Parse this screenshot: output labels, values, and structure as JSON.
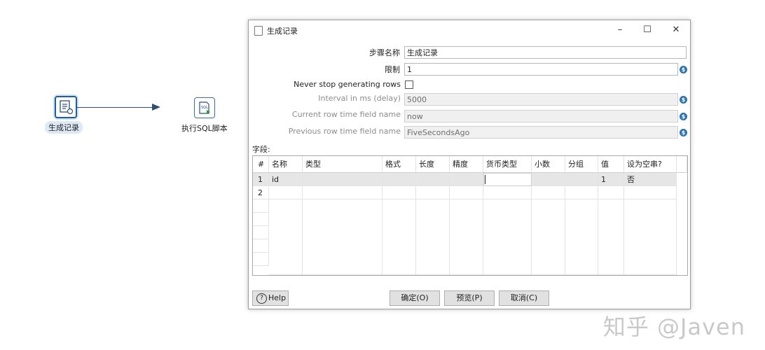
{
  "canvas": {
    "step1_label": "生成记录",
    "step2_label": "执行SQL脚本",
    "step2_icon_text": "SQL"
  },
  "dialog": {
    "title": "生成记录",
    "window_buttons": {
      "minimize": "–",
      "maximize": "☐",
      "close": "✕"
    },
    "fields": {
      "step_name": {
        "label": "步骤名称",
        "value": "生成记录"
      },
      "limit": {
        "label": "限制",
        "value": "1"
      },
      "never_stop": {
        "label": "Never stop generating rows"
      },
      "interval": {
        "label": "Interval in ms (delay)",
        "value": "5000"
      },
      "current_row_time": {
        "label": "Current row time field name",
        "value": "now"
      },
      "previous_row_time": {
        "label": "Previous row time field name",
        "value": "FiveSecondsAgo"
      }
    },
    "var_icon": "$",
    "fields_section_label": "字段:",
    "table": {
      "headers": [
        "#",
        "名称",
        "类型",
        "格式",
        "长度",
        "精度",
        "货币类型",
        "小数",
        "分组",
        "值",
        "设为空串?"
      ],
      "rows": [
        [
          "1",
          "id",
          "",
          "",
          "",
          "",
          "",
          "",
          "",
          "1",
          "否"
        ],
        [
          "2",
          "",
          "",
          "",
          "",
          "",
          "",
          "",
          "",
          "",
          ""
        ]
      ]
    },
    "buttons": {
      "help": "Help",
      "help_icon": "?",
      "ok": "确定(O)",
      "preview": "预览(P)",
      "cancel": "取消(C)"
    }
  },
  "watermark": "知乎 @Javen"
}
